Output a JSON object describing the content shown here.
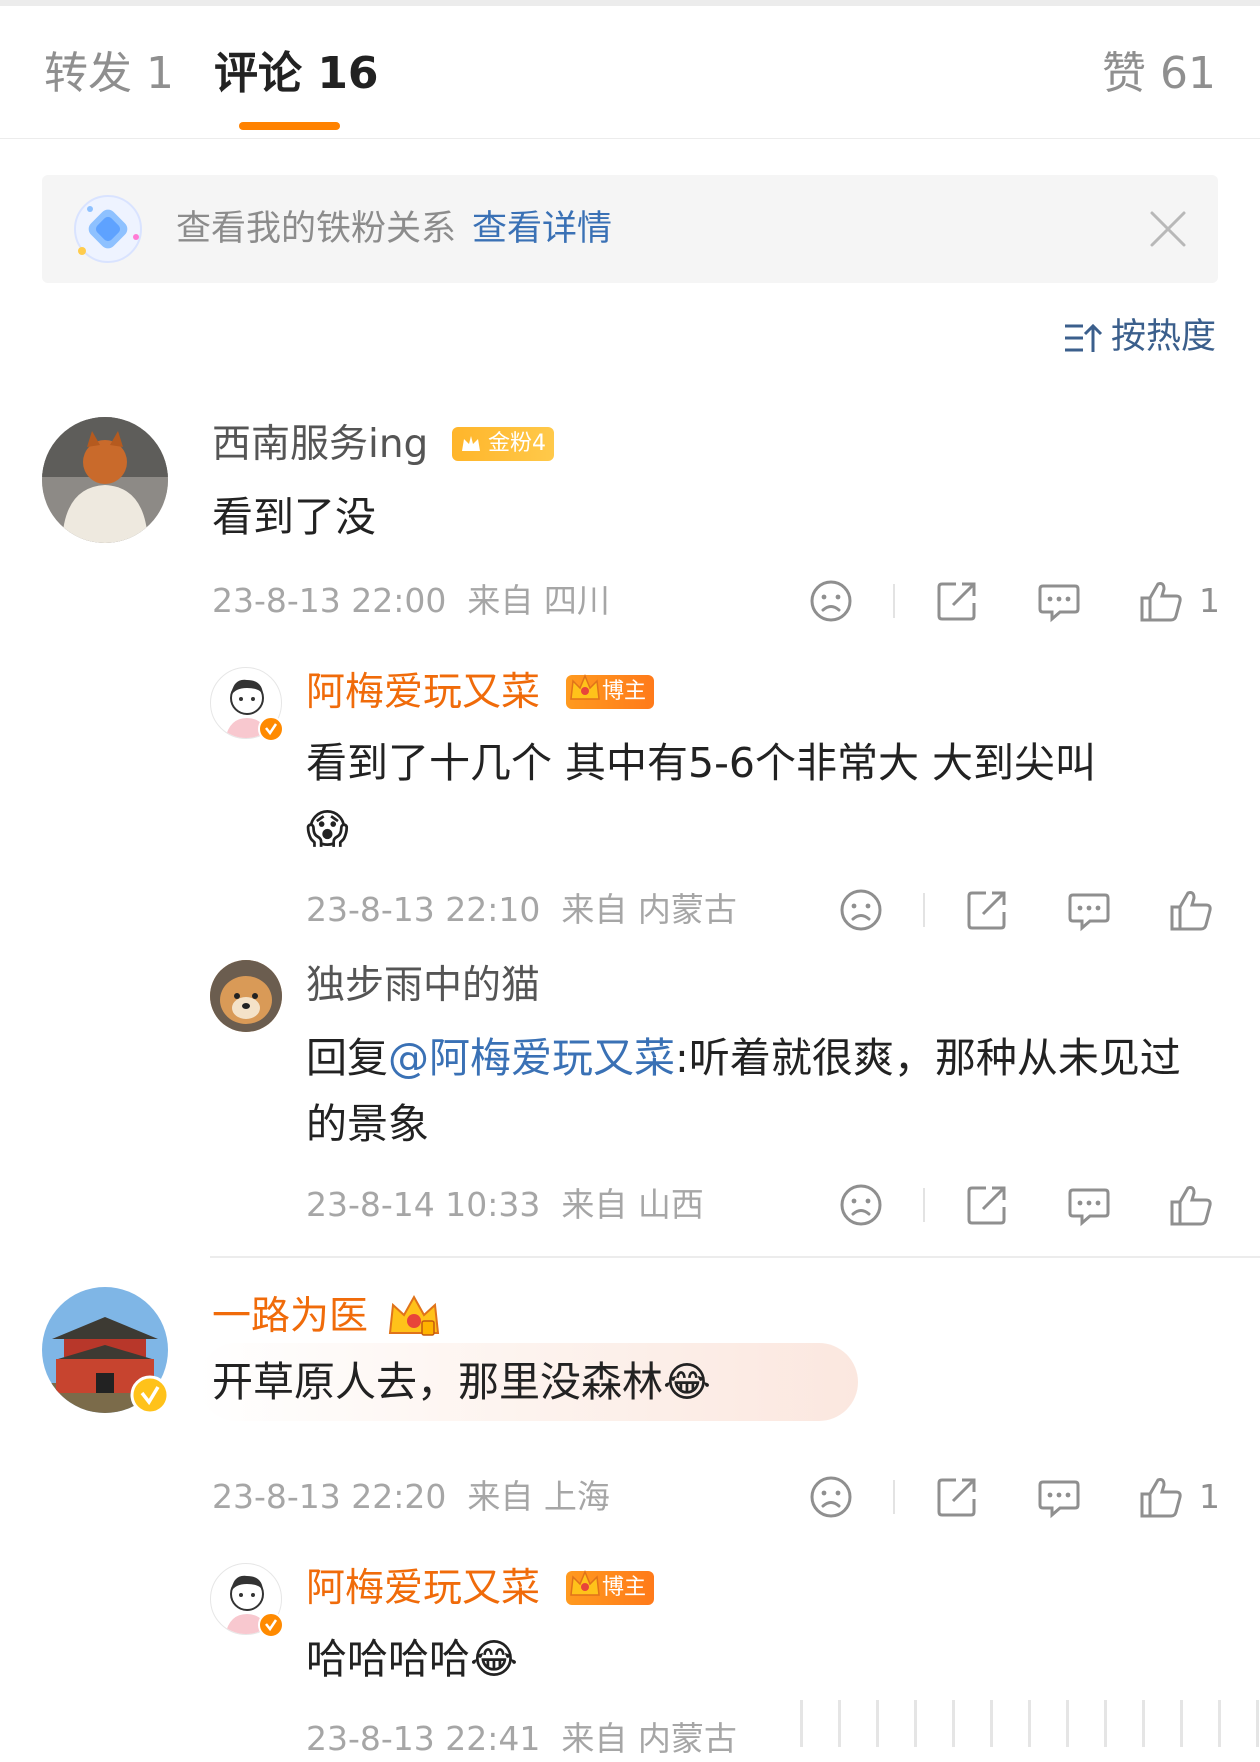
{
  "tabs": {
    "repost": "转发 1",
    "comments": "评论 16",
    "likes": "赞 61"
  },
  "banner": {
    "text": "查看我的铁粉关系",
    "link": "查看详情"
  },
  "sort": {
    "label": "按热度"
  },
  "comments": [
    {
      "user": "西南服务ing",
      "badge": "金粉4",
      "text": "看到了没",
      "time": "23-8-13 22:00",
      "from": "来自 四川",
      "likes": "1",
      "replies": [
        {
          "user": "阿梅爱玩又菜",
          "badge": "博主",
          "text": "看到了十几个 其中有5-6个非常大 大到尖叫",
          "emoji": "😱",
          "time": "23-8-13 22:10",
          "from": "来自 内蒙古"
        },
        {
          "user": "独步雨中的猫",
          "reply_prefix": "回复",
          "mention": "@阿梅爱玩又菜",
          "text": ":听着就很爽，那种从未见过的景象",
          "time": "23-8-14 10:33",
          "from": "来自 山西"
        }
      ]
    },
    {
      "user": "一路为医",
      "text": "开草原人去，那里没森林",
      "emoji": "😂",
      "time": "23-8-13 22:20",
      "from": "来自 上海",
      "likes": "1",
      "replies": [
        {
          "user": "阿梅爱玩又菜",
          "badge": "博主",
          "text": "哈哈哈哈",
          "emoji": "😂",
          "time": "23-8-13 22:41",
          "from": "来自 内蒙古"
        }
      ]
    }
  ],
  "colors": {
    "accent": "#ff8200",
    "link": "#3a71b5",
    "username_vip": "#f06b0a"
  }
}
